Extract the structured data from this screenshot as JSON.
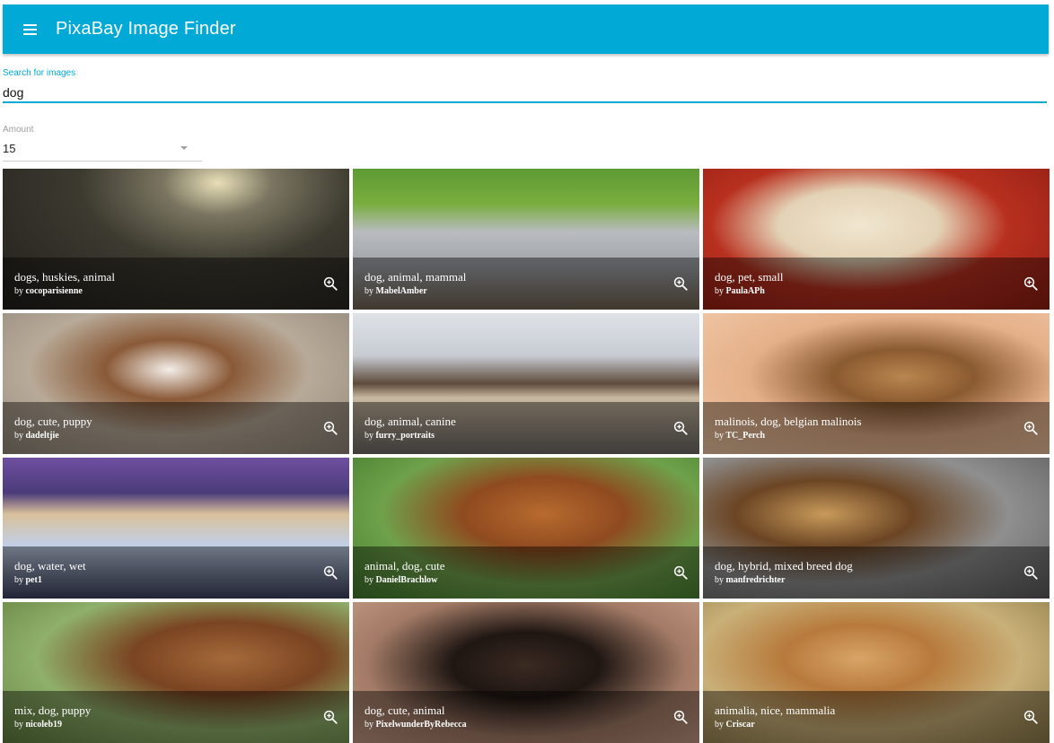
{
  "appbar": {
    "title": "PixaBay Image Finder",
    "menu_icon": "menu-icon",
    "color": "#00a9d6"
  },
  "search": {
    "label": "Search for images",
    "value": "dog"
  },
  "amount": {
    "label": "Amount",
    "value": "15"
  },
  "images": [
    {
      "tags": "dogs, huskies, animal",
      "by_prefix": "by",
      "author": "cocoparisienne"
    },
    {
      "tags": "dog, animal, mammal",
      "by_prefix": "by",
      "author": "MabelAmber"
    },
    {
      "tags": "dog, pet, small",
      "by_prefix": "by",
      "author": "PaulaAPh"
    },
    {
      "tags": "dog, cute, puppy",
      "by_prefix": "by",
      "author": "dadeltjie"
    },
    {
      "tags": "dog, animal, canine",
      "by_prefix": "by",
      "author": "furry_portraits"
    },
    {
      "tags": "malinois, dog, belgian malinois",
      "by_prefix": "by",
      "author": "TC_Perch"
    },
    {
      "tags": "dog, water, wet",
      "by_prefix": "by",
      "author": "pet1"
    },
    {
      "tags": "animal, dog, cute",
      "by_prefix": "by",
      "author": "DanielBrachlow"
    },
    {
      "tags": "dog, hybrid, mixed breed dog",
      "by_prefix": "by",
      "author": "manfredrichter"
    },
    {
      "tags": "mix, dog, puppy",
      "by_prefix": "by",
      "author": "nicoleb19"
    },
    {
      "tags": "dog, cute, animal",
      "by_prefix": "by",
      "author": "PixelwunderByRebecca"
    },
    {
      "tags": "animalia, nice, mammalia",
      "by_prefix": "by",
      "author": "Criscar"
    }
  ],
  "zoom_icon": "zoom-in-icon"
}
